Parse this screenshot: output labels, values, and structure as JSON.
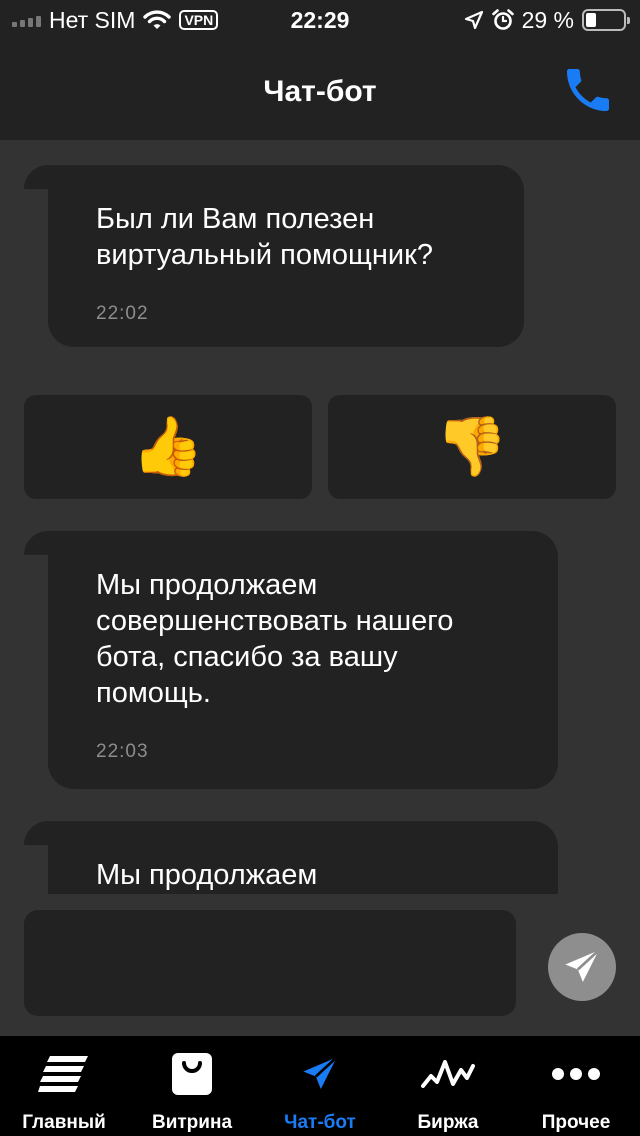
{
  "status_bar": {
    "carrier": "Нет SIM",
    "vpn": "VPN",
    "time": "22:29",
    "battery_percent": "29 %",
    "battery_level": 0.29
  },
  "header": {
    "title": "Чат-бот",
    "call_icon": "phone-icon"
  },
  "messages": [
    {
      "text": "Был ли Вам полезен виртуальный помощник?",
      "time": "22:02"
    },
    {
      "text": "Мы продолжаем совершенствовать нашего бота, спасибо за вашу помощь.",
      "time": "22:03"
    },
    {
      "text": "Мы продолжаем"
    }
  ],
  "reactions": {
    "like": "👍",
    "dislike": "👎"
  },
  "composer": {
    "value": "",
    "placeholder": "",
    "send_icon": "send-icon"
  },
  "tabs": [
    {
      "label": "Главный",
      "icon": "home-icon"
    },
    {
      "label": "Витрина",
      "icon": "shopping-bag-icon"
    },
    {
      "label": "Чат-бот",
      "icon": "paper-plane-icon",
      "active": true
    },
    {
      "label": "Биржа",
      "icon": "chart-line-icon"
    },
    {
      "label": "Прочее",
      "icon": "more-icon"
    }
  ],
  "colors": {
    "accent": "#1a7cf5",
    "background": "#333333",
    "surface": "#222222",
    "tab_bar": "#000000",
    "send_button": "#8e8e8e"
  }
}
